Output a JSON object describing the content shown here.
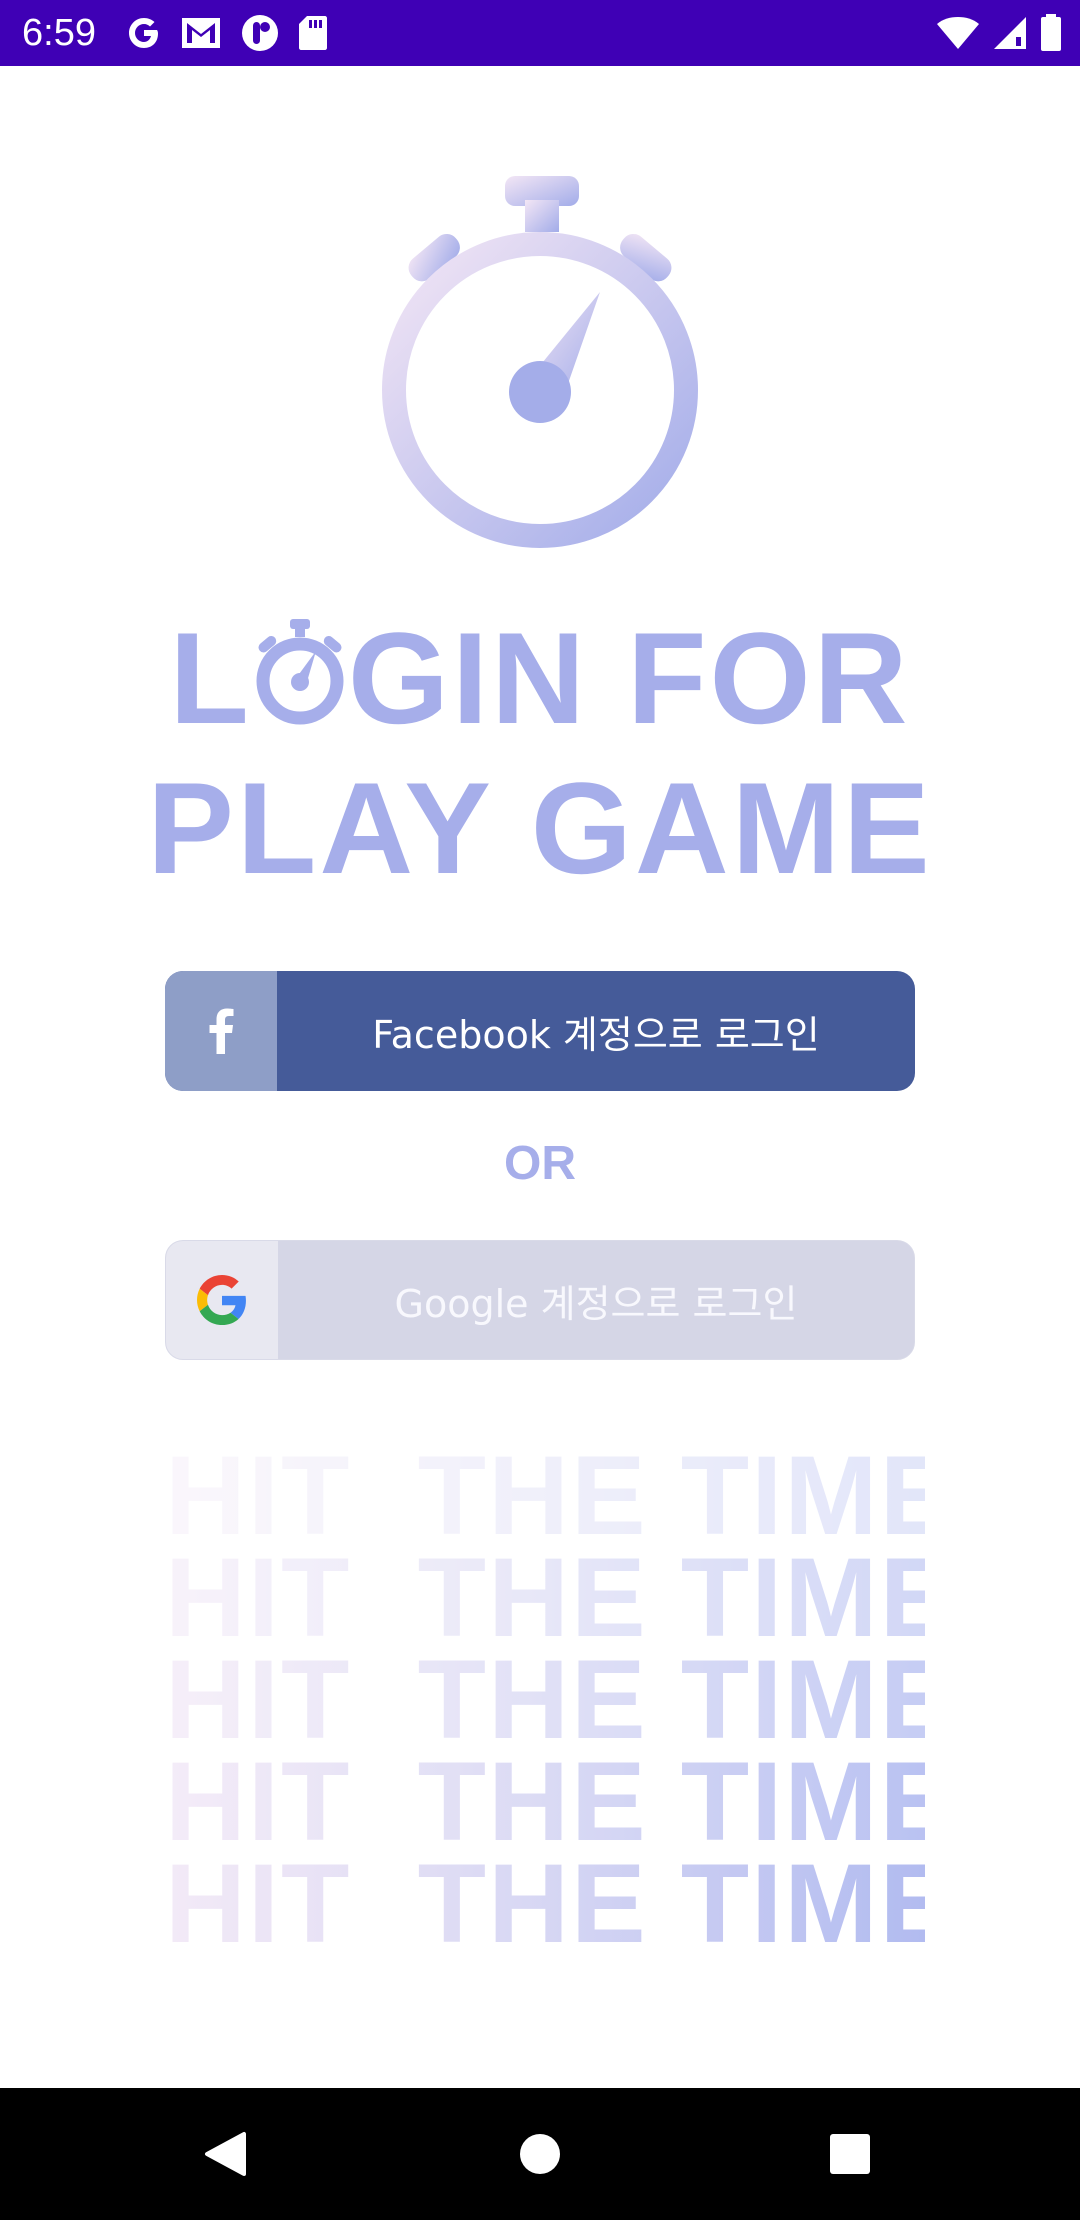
{
  "status_bar": {
    "time": "6:59",
    "left_icons": [
      "google-g-icon",
      "gmail-icon",
      "tap-app-icon",
      "sd-card-icon"
    ],
    "right_icons": [
      "wifi-icon",
      "cellular-signal-icon",
      "battery-icon"
    ],
    "background": "#3f00b5"
  },
  "hero": {
    "logo_icon": "stopwatch-icon",
    "title_line1_before": "L",
    "title_line1_after": "GIN FOR",
    "title_line2": "PLAY GAME",
    "title_color": "#a6aeea"
  },
  "facebook_button": {
    "icon": "facebook-f-icon",
    "label": "Facebook 계정으로 로그인",
    "color": "#455b99"
  },
  "or_text": "OR",
  "google_button": {
    "icon": "google-g-icon",
    "label": "Google 계정으로 로그인",
    "color": "#d5d6e6"
  },
  "decoration": {
    "lines": [
      "HIT  THE TIME",
      "HIT  THE TIME",
      "HIT  THE TIME",
      "HIT  THE TIME",
      "HIT  THE TIME"
    ]
  },
  "nav_bar": {
    "items": [
      "back-icon",
      "home-icon",
      "recents-icon"
    ]
  }
}
